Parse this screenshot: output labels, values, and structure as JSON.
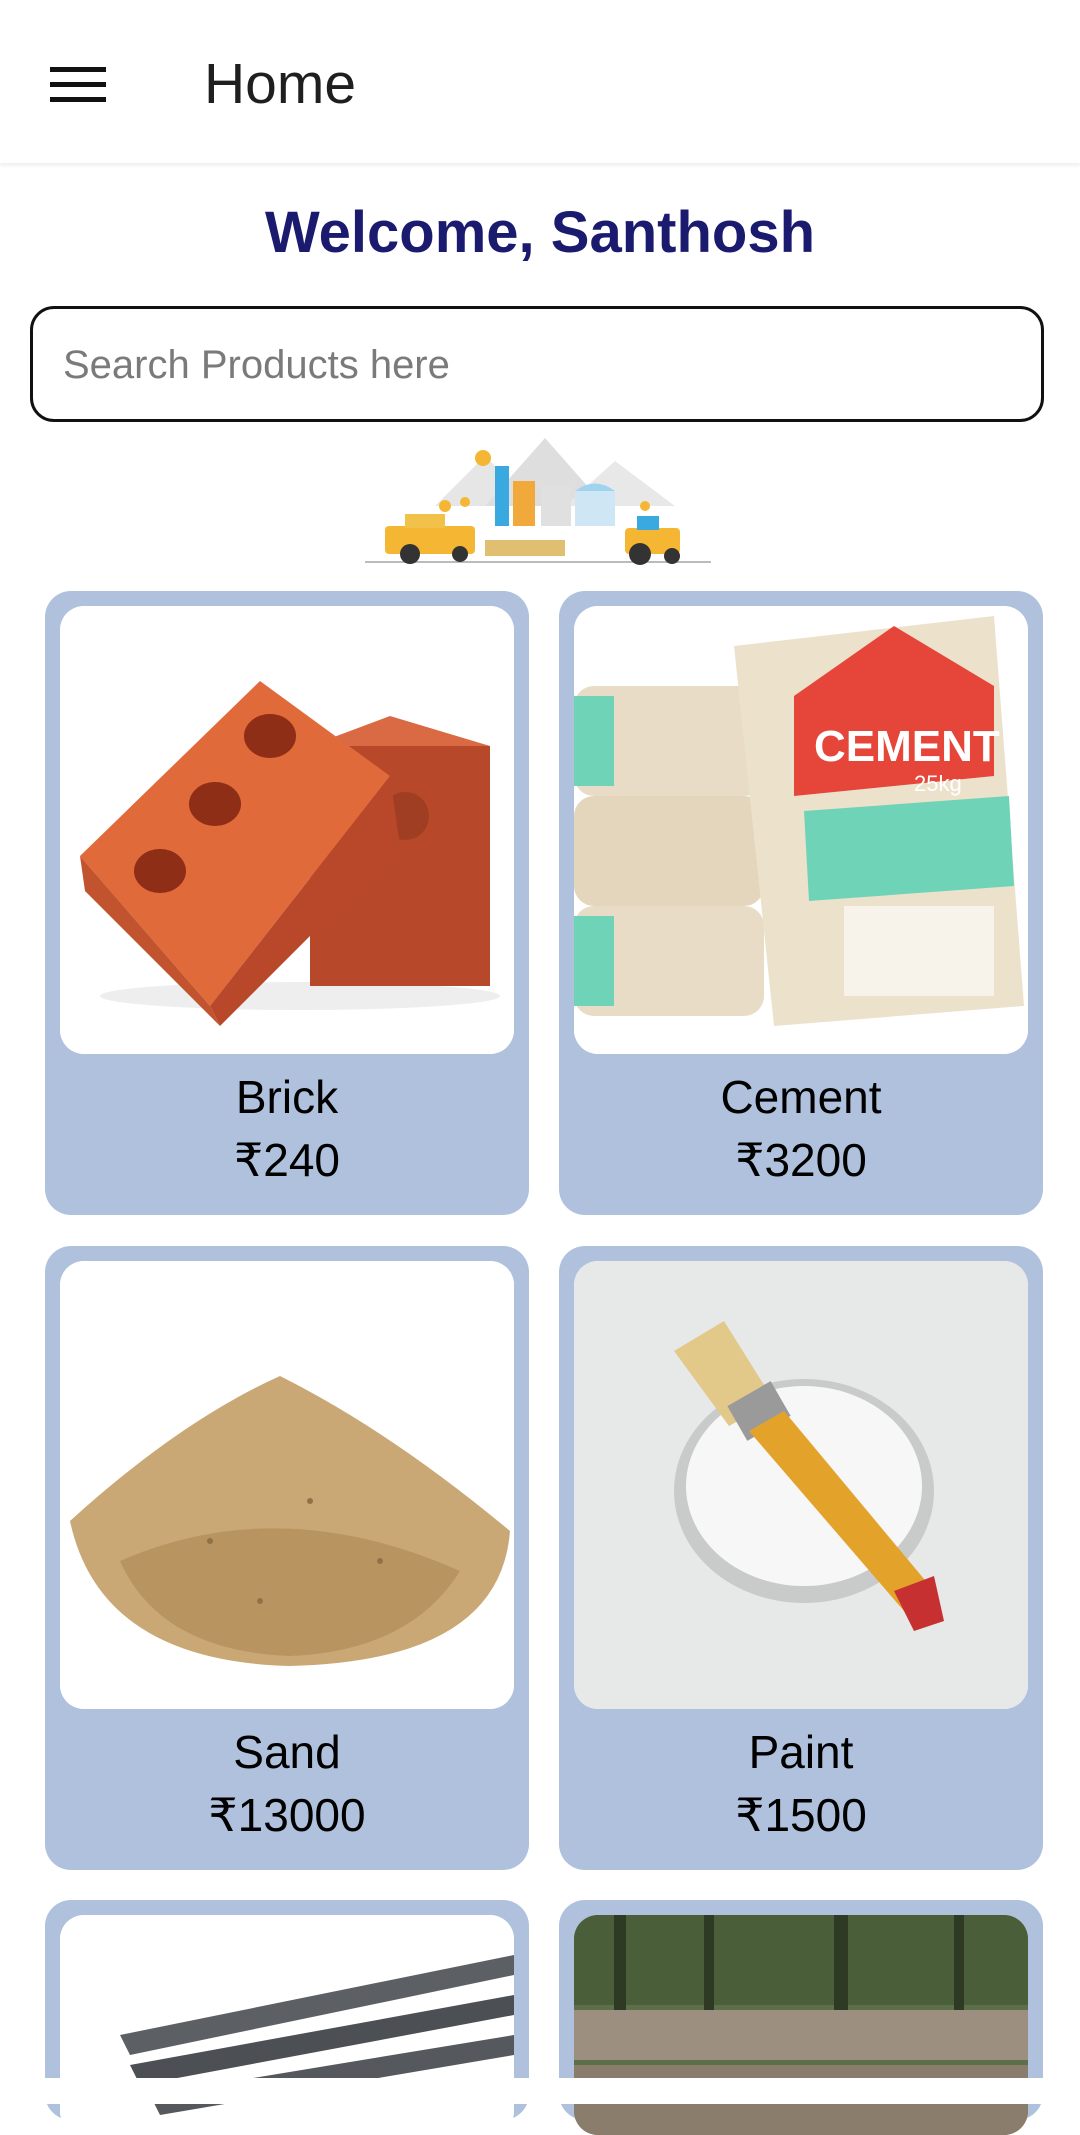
{
  "appbar": {
    "title": "Home",
    "menu_icon": "hamburger-menu-icon"
  },
  "welcome_text": "Welcome, Santhosh",
  "search": {
    "placeholder": "Search Products here",
    "value": ""
  },
  "banner": {
    "icon": "farm-illustration"
  },
  "products": [
    {
      "name": "Brick",
      "price": "₹240",
      "image": "brick-image"
    },
    {
      "name": "Cement",
      "price": "₹3200",
      "image": "cement-bags-image"
    },
    {
      "name": "Sand",
      "price": "₹13000",
      "image": "sand-pile-image"
    },
    {
      "name": "Paint",
      "price": "₹1500",
      "image": "paint-brush-image"
    },
    {
      "name": "",
      "price": "",
      "image": "steel-rods-image"
    },
    {
      "name": "",
      "price": "",
      "image": "wood-logs-image"
    }
  ],
  "colors": {
    "card_background": "#afc1dc",
    "welcome_text": "#1a1a6e",
    "page_background": "#ffffff"
  }
}
